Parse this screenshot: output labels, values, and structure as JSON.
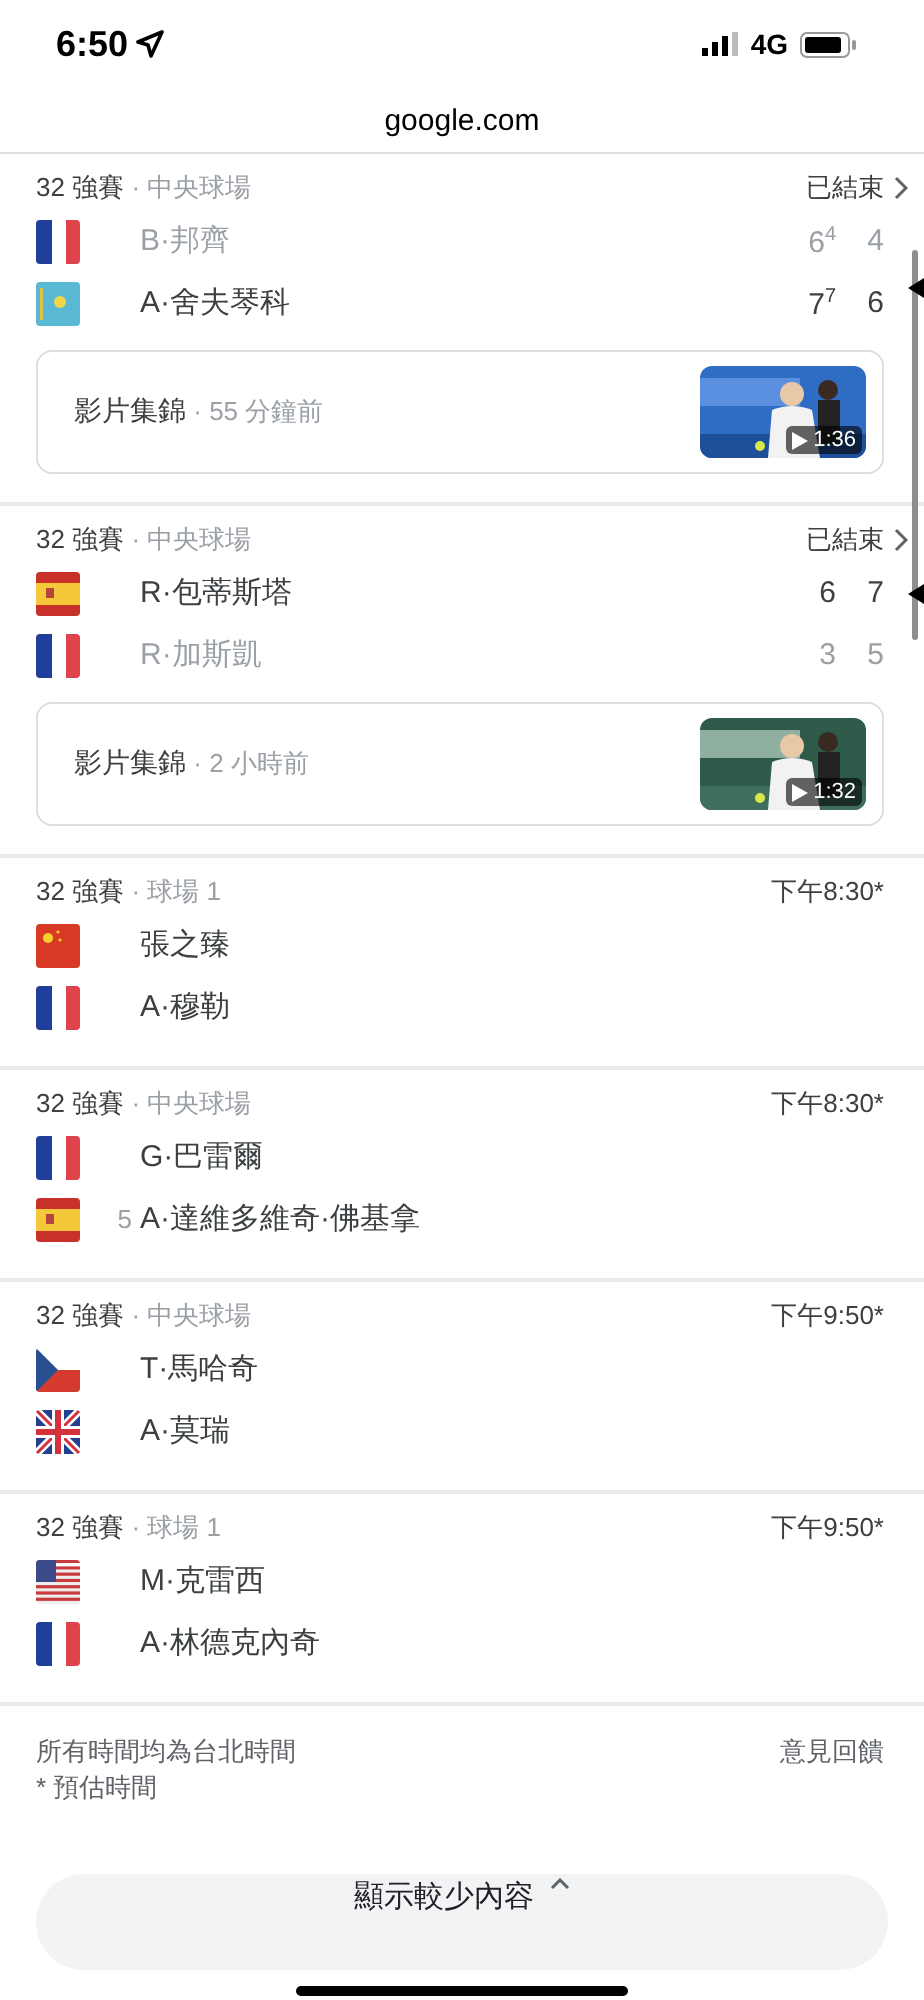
{
  "status_bar": {
    "time": "6:50",
    "network": "4G"
  },
  "address_bar": {
    "url": "google.com"
  },
  "matches": [
    {
      "kind": "result",
      "round": "32 強賽",
      "court": "· 中央球場",
      "status": "已結束",
      "players": [
        {
          "kind": "fr",
          "name": "B·邦齊",
          "winner": false,
          "scores": [
            "6$^{4}$",
            "4"
          ]
        },
        {
          "kind": "kz",
          "name": "A·舍夫琴科",
          "winner": true,
          "scores": [
            "7$^{7}$",
            "6"
          ]
        }
      ],
      "video": {
        "label": "影片集錦",
        "age": "· 55 分鐘前",
        "duration": "1:36"
      }
    },
    {
      "kind": "result",
      "round": "32 強賽",
      "court": "· 中央球場",
      "status": "已結束",
      "players": [
        {
          "kind": "es",
          "name": "R·包蒂斯塔",
          "winner": true,
          "scores": [
            "6",
            "7"
          ]
        },
        {
          "kind": "fr",
          "name": "R·加斯凱",
          "winner": false,
          "scores": [
            "3",
            "5"
          ]
        }
      ],
      "video": {
        "label": "影片集錦",
        "age": "· 2 小時前",
        "duration": "1:32"
      }
    },
    {
      "kind": "scheduled",
      "round": "32 強賽",
      "court": "· 球場 1",
      "status": "下午8:30*",
      "players": [
        {
          "kind": "cn",
          "name": "張之臻"
        },
        {
          "kind": "fr",
          "name": "A·穆勒"
        }
      ]
    },
    {
      "kind": "scheduled",
      "round": "32 強賽",
      "court": "· 中央球場",
      "status": "下午8:30*",
      "players": [
        {
          "kind": "fr",
          "name": "G·巴雷爾"
        },
        {
          "kind": "es",
          "seed": "5",
          "name": "A·達維多維奇·佛基拿"
        }
      ]
    },
    {
      "kind": "scheduled",
      "round": "32 強賽",
      "court": "· 中央球場",
      "status": "下午9:50*",
      "players": [
        {
          "kind": "cz",
          "name": "T·馬哈奇"
        },
        {
          "kind": "gb",
          "name": "A·莫瑞"
        }
      ]
    },
    {
      "kind": "scheduled",
      "round": "32 強賽",
      "court": "· 球場 1",
      "status": "下午9:50*",
      "players": [
        {
          "kind": "us",
          "name": "M·克雷西"
        },
        {
          "kind": "fr",
          "name": "A·林德克內奇"
        }
      ]
    }
  ],
  "footer": {
    "notes": [
      "所有時間均為台北時間",
      "* 預估時間"
    ],
    "feedback": "意見回饋"
  },
  "show_less_button": {
    "label": "顯示較少內容"
  }
}
